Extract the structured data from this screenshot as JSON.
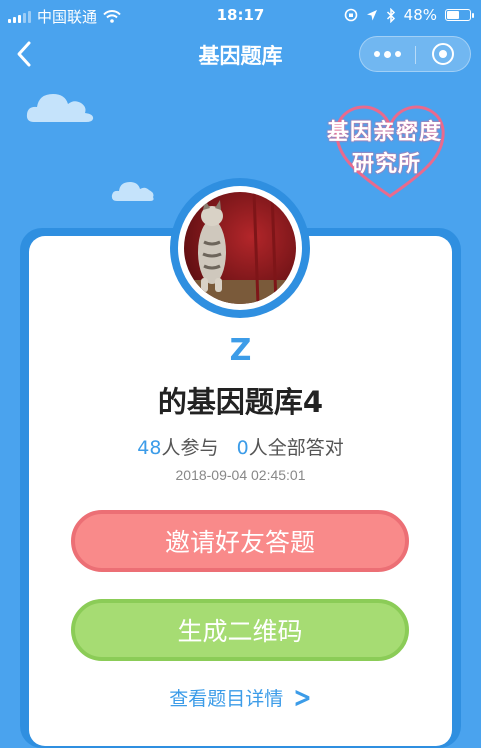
{
  "status_bar": {
    "carrier": "中国联通",
    "time": "18:17",
    "battery_percent": "48%",
    "battery_level": 0.48,
    "icons": [
      "signal-icon",
      "wifi-icon",
      "orientation-lock-icon",
      "location-icon",
      "bluetooth-icon",
      "battery-icon"
    ]
  },
  "nav": {
    "title": "基因题库",
    "back_icon": "back-chevron-icon",
    "more_icon": "more-dots-icon",
    "close_icon": "close-capsule-icon"
  },
  "logo": {
    "line1": "基因亲密度",
    "line2": "研究所",
    "heart_color": "#e96a8d"
  },
  "profile": {
    "avatar_alt": "cat-avatar",
    "creator_name": "Z",
    "bank_title": "的基因题库4"
  },
  "stats": {
    "participants": "48",
    "participants_label": "人参与",
    "all_correct": "0",
    "all_correct_label": "人全部答对"
  },
  "timestamp": "2018-09-04 02:45:01",
  "actions": {
    "invite_label": "邀请好友答题",
    "qrcode_label": "生成二维码",
    "detail_label": "查看题目详情",
    "detail_icon": "chevron-right-icon"
  },
  "colors": {
    "background": "#4aa3ee",
    "accent": "#3c9ce8",
    "invite_button": "#f98a8a",
    "qrcode_button": "#a6dc73"
  }
}
